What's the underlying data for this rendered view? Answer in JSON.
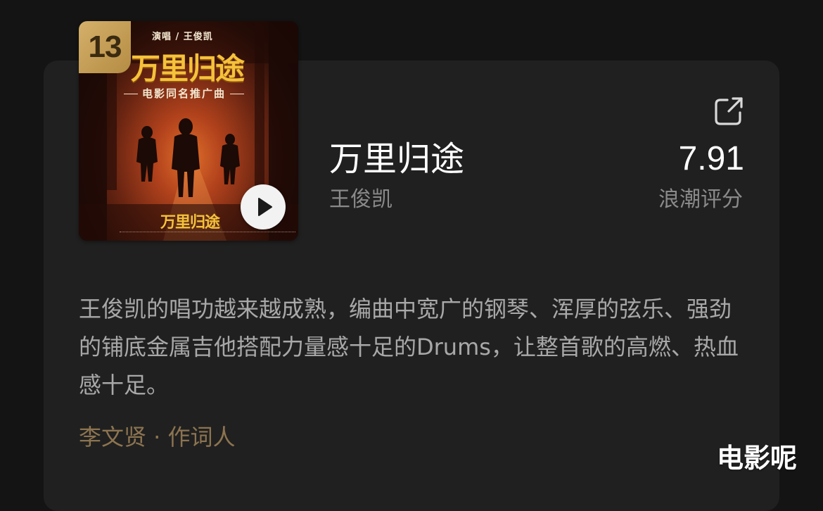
{
  "cover": {
    "rank": "13",
    "singer_credit": "演唱 / 王俊凯",
    "title_art": "万里归途",
    "subtitle": "电影同名推广曲",
    "logo_art": "万里归途"
  },
  "song": {
    "title": "万里归途",
    "artist": "王俊凯"
  },
  "score": {
    "value": "7.91",
    "label": "浪潮评分"
  },
  "review": {
    "text": "王俊凯的唱功越来越成熟，编曲中宽广的钢琴、浑厚的弦乐、强劲的铺底金属吉他搭配力量感十足的Drums，让整首歌的高燃、热血感十足。"
  },
  "author": {
    "text": "李文贤 · 作词人"
  },
  "watermark": {
    "text": "电影呢"
  },
  "icons": {
    "share": "share-icon",
    "play": "play-icon"
  },
  "colors": {
    "background": "#141414",
    "card": "#202020",
    "title": "#ffffff",
    "muted": "#8a8a8a",
    "author": "#8c7450",
    "badge": "#c9a45a"
  }
}
